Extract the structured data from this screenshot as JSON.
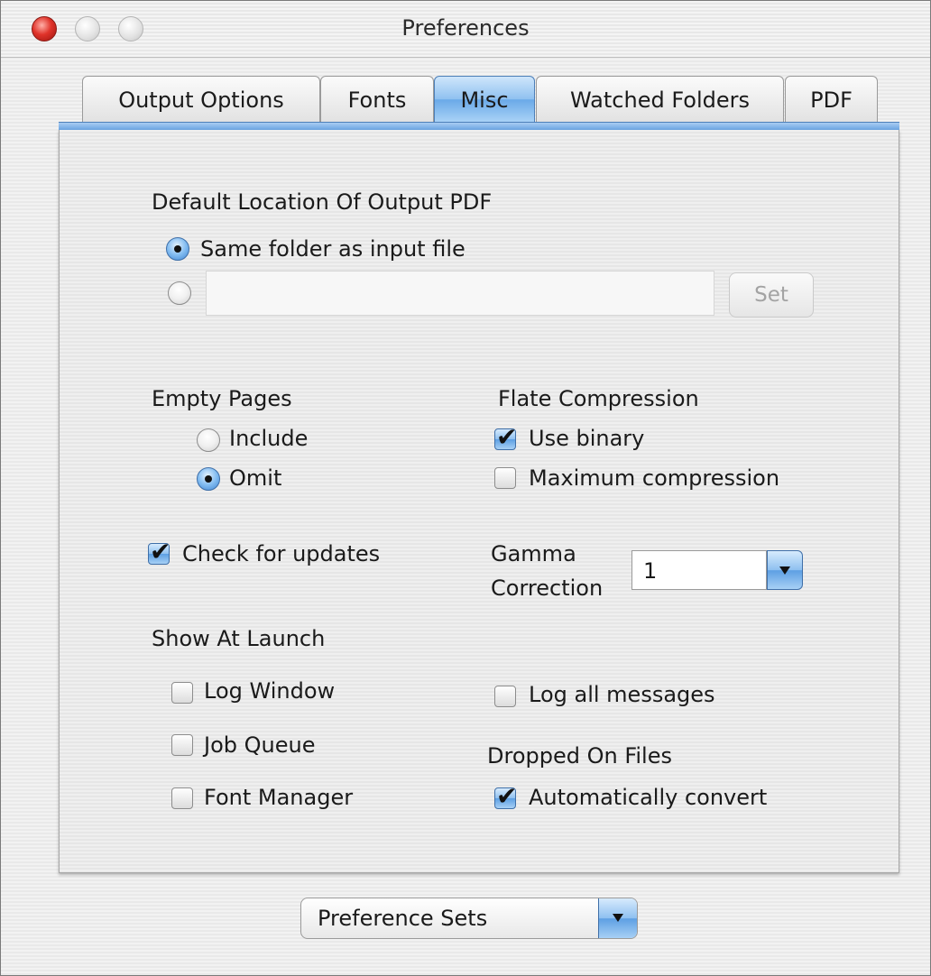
{
  "window": {
    "title": "Preferences"
  },
  "tabs": [
    {
      "label": "Output Options",
      "active": false
    },
    {
      "label": "Fonts",
      "active": false
    },
    {
      "label": "Misc",
      "active": true
    },
    {
      "label": "Watched Folders",
      "active": false
    },
    {
      "label": "PDF",
      "active": false
    }
  ],
  "output_location": {
    "heading": "Default Location Of Output PDF",
    "same_folder_label": "Same folder as input file",
    "same_folder_selected": true,
    "custom_selected": false,
    "custom_path_value": "",
    "set_button_label": "Set"
  },
  "empty_pages": {
    "heading": "Empty Pages",
    "include_label": "Include",
    "include_selected": false,
    "omit_label": "Omit",
    "omit_selected": true
  },
  "flate_compression": {
    "heading": "Flate Compression",
    "use_binary_label": "Use binary",
    "use_binary_checked": true,
    "max_compression_label": "Maximum compression",
    "max_compression_checked": false
  },
  "check_updates": {
    "label": "Check for updates",
    "checked": true
  },
  "gamma": {
    "label_line1": "Gamma",
    "label_line2": "Correction",
    "value": "1"
  },
  "show_at_launch": {
    "heading": "Show At Launch",
    "log_window_label": "Log Window",
    "log_window_checked": false,
    "job_queue_label": "Job Queue",
    "job_queue_checked": false,
    "font_manager_label": "Font Manager",
    "font_manager_checked": false
  },
  "log_all": {
    "label": "Log all messages",
    "checked": false
  },
  "dropped_files": {
    "heading": "Dropped On Files",
    "auto_convert_label": "Automatically convert",
    "auto_convert_checked": true
  },
  "preference_sets": {
    "label": "Preference Sets"
  },
  "colors": {
    "accent_blue": "#6aa9e8",
    "disabled_text": "#a3a3a3"
  }
}
